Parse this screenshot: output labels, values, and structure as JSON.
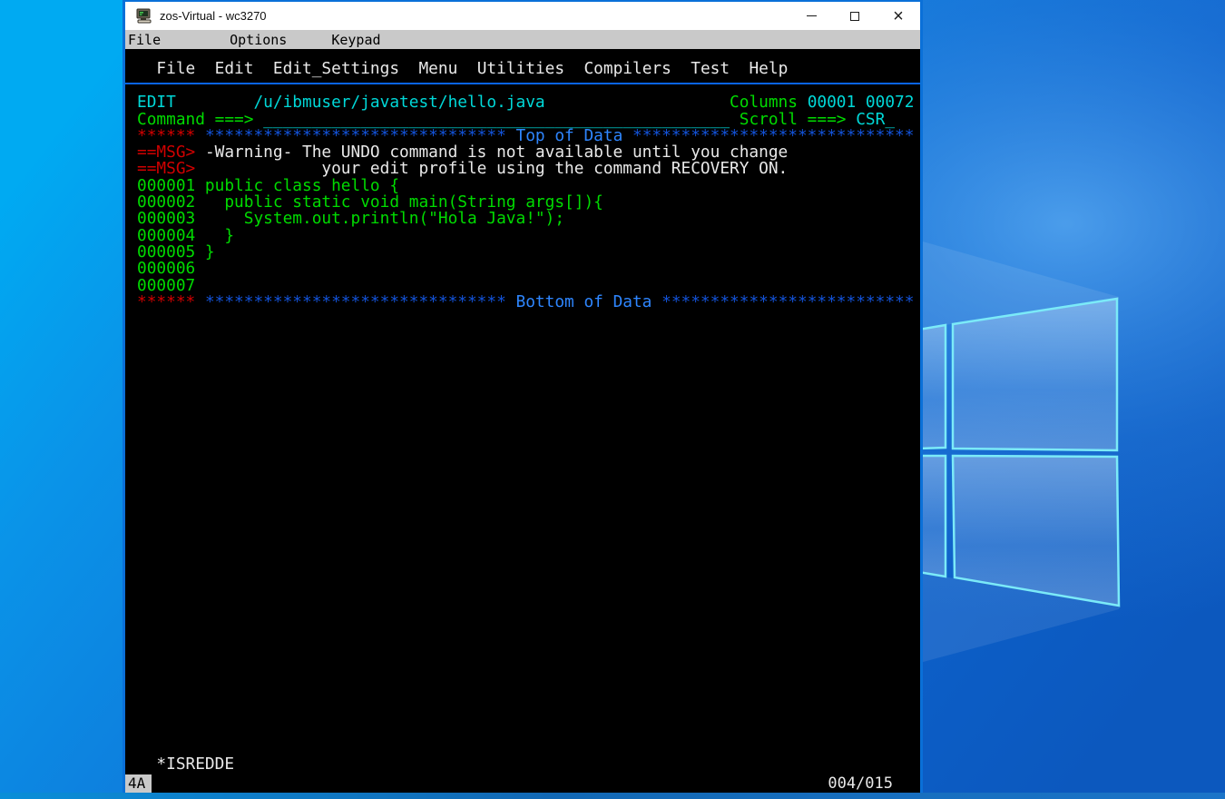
{
  "window": {
    "title": "zos-Virtual - wc3270",
    "menubar": [
      "File",
      "Options",
      "Keypad"
    ],
    "controls": {
      "minimize": "minimize",
      "maximize": "maximize",
      "close": "close"
    }
  },
  "terminal": {
    "action_bar_items": [
      "File",
      "Edit",
      "Edit_Settings",
      "Menu",
      "Utilities",
      "Compilers",
      "Test",
      "Help"
    ],
    "rows": [
      [
        {
          "t": "EDIT        /u/ibmuser/javatest/hello.java                   ",
          "c": "cyan"
        },
        {
          "t": "Columns ",
          "c": "green"
        },
        {
          "t": "00001 00072",
          "c": "cyan"
        }
      ],
      [
        {
          "t": "Command ===> ",
          "c": "green"
        },
        {
          "t": "________________________________________________",
          "c": "cyan"
        },
        {
          "t": " Scroll ===> ",
          "c": "green"
        },
        {
          "t": "CSR_",
          "c": "cyan"
        }
      ],
      [
        {
          "t": "****** ",
          "c": "red"
        },
        {
          "t": "*******************************",
          "c": "blue"
        },
        {
          "t": " Top of Data ",
          "c": "bblue"
        },
        {
          "t": "*****************************",
          "c": "blue"
        }
      ],
      [
        {
          "t": "==MSG> ",
          "c": "red"
        },
        {
          "t": "-Warning- The UNDO command is not available until you change",
          "c": "white"
        }
      ],
      [
        {
          "t": "==MSG> ",
          "c": "red"
        },
        {
          "t": "            your edit profile using the command RECOVERY ON.",
          "c": "white"
        }
      ],
      [
        {
          "t": "000001 public class hello {",
          "c": "green"
        }
      ],
      [
        {
          "t": "000002   public static void main(String args[]){",
          "c": "green"
        }
      ],
      [
        {
          "t": "000003     System.out.println(\"Hola Java!\");",
          "c": "green"
        }
      ],
      [
        {
          "t": "000004   }",
          "c": "green"
        }
      ],
      [
        {
          "t": "000005 }",
          "c": "green"
        }
      ],
      [
        {
          "t": "000006",
          "c": "green"
        }
      ],
      [
        {
          "t": "000007",
          "c": "green"
        }
      ],
      [
        {
          "t": "****** ",
          "c": "red"
        },
        {
          "t": "*******************************",
          "c": "blue"
        },
        {
          "t": " Bottom of Data ",
          "c": "bblue"
        },
        {
          "t": "**************************",
          "c": "blue"
        }
      ]
    ],
    "status_line": "  *ISREDDE",
    "oia": {
      "status": "4A",
      "cursor": "004/015"
    }
  },
  "colors": {
    "green": "#00db00",
    "cyan": "#00d8d8",
    "red": "#d10000",
    "blue": "#1353d9",
    "bblue": "#2e86ff",
    "white": "#e9e9e9",
    "accent": "#0a70d8",
    "sepblue": "#0a64e8"
  }
}
